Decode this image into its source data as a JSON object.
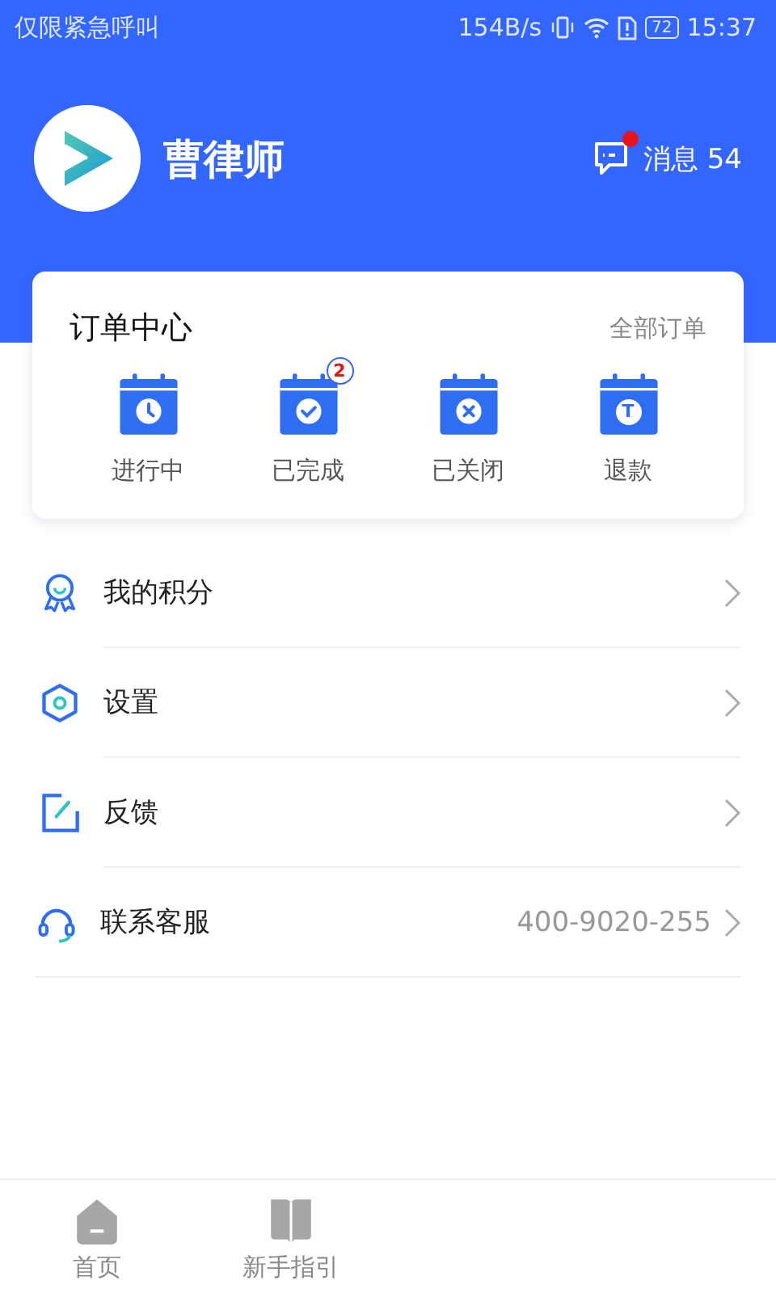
{
  "status_bar": {
    "carrier": "仅限紧急呼叫",
    "speed": "154B/s",
    "battery": "72",
    "time": "15:37"
  },
  "profile": {
    "name": "曹律师",
    "messages_label": "消息",
    "messages_count": "54",
    "unread": true
  },
  "order_center": {
    "title": "订单中心",
    "all_link": "全部订单",
    "statuses": [
      {
        "kind": "clock",
        "label": "进行中"
      },
      {
        "kind": "check",
        "label": "已完成",
        "badge": "2"
      },
      {
        "kind": "cross",
        "label": "已关闭"
      },
      {
        "kind": "refund",
        "label": "退款",
        "glyph": "T"
      }
    ]
  },
  "menu": [
    {
      "kind": "medal",
      "label": "我的积分"
    },
    {
      "kind": "settings",
      "label": "设置"
    },
    {
      "kind": "edit",
      "label": "反馈"
    },
    {
      "kind": "headset",
      "label": "联系客服",
      "value": "400-9020-255"
    }
  ],
  "tab_bar": [
    {
      "kind": "home",
      "label": "首页",
      "selected": false
    },
    {
      "kind": "book",
      "label": "新手指引",
      "selected": false
    }
  ]
}
